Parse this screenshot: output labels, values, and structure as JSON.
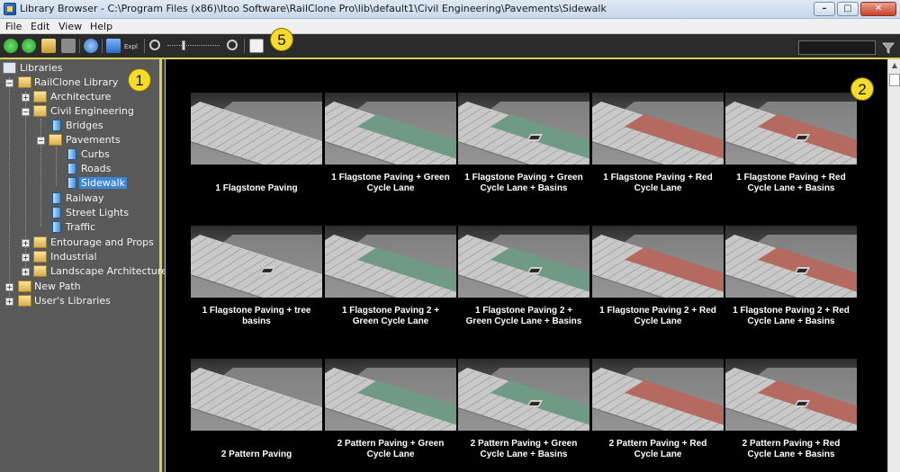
{
  "window": {
    "title": "Library Browser - C:\\Program Files (x86)\\Itoo Software\\RailClone Pro\\lib\\default1\\Civil Engineering\\Pavements\\Sidewalk"
  },
  "menu": [
    "File",
    "Edit",
    "View",
    "Help"
  ],
  "toolbar": {
    "buttons": [
      "back-arrow-icon",
      "forward-arrow-icon",
      "open-folder-icon",
      "save-icon",
      "refresh-icon",
      "export-icon",
      "zoom-out-icon",
      "zoom-in-icon",
      "checklist-icon"
    ],
    "export_label": "Expl",
    "search_value": ""
  },
  "callouts": [
    "1",
    "2",
    "5"
  ],
  "tree": [
    {
      "label": "Libraries",
      "icon": "libraries-icon"
    },
    {
      "label": "RailClone Library",
      "icon": "folder-open-icon"
    },
    {
      "label": "Architecture",
      "icon": "folder-icon"
    },
    {
      "label": "Civil Engineering",
      "icon": "folder-open-icon"
    },
    {
      "label": "Bridges",
      "icon": "book-icon"
    },
    {
      "label": "Pavements",
      "icon": "folder-open-icon"
    },
    {
      "label": "Curbs",
      "icon": "book-icon"
    },
    {
      "label": "Roads",
      "icon": "book-icon"
    },
    {
      "label": "Sidewalk",
      "icon": "book-icon",
      "selected": true
    },
    {
      "label": "Railway",
      "icon": "book-icon"
    },
    {
      "label": "Street Lights",
      "icon": "book-icon"
    },
    {
      "label": "Traffic",
      "icon": "book-icon"
    },
    {
      "label": "Entourage and Props",
      "icon": "folder-icon"
    },
    {
      "label": "Industrial",
      "icon": "folder-icon"
    },
    {
      "label": "Landscape Architecture",
      "icon": "folder-icon"
    },
    {
      "label": "New Path",
      "icon": "folder-icon"
    },
    {
      "label": "User's Libraries",
      "icon": "folder-icon"
    }
  ],
  "items": [
    {
      "line1": "1 Flagstone Paving",
      "line2": "",
      "lane": "none",
      "basin": false
    },
    {
      "line1": "1 Flagstone Paving + Green",
      "line2": "Cycle Lane",
      "lane": "green",
      "basin": false
    },
    {
      "line1": "1 Flagstone Paving + Green",
      "line2": "Cycle Lane + Basins",
      "lane": "green",
      "basin": true
    },
    {
      "line1": "1 Flagstone Paving + Red",
      "line2": "Cycle Lane",
      "lane": "red",
      "basin": false
    },
    {
      "line1": "1 Flagstone Paving + Red",
      "line2": "Cycle Lane + Basins",
      "lane": "red",
      "basin": true
    },
    {
      "line1": "1 Flagstone Paving + tree",
      "line2": "basins",
      "lane": "none",
      "basin": true
    },
    {
      "line1": "1 Flagstone Paving 2 +",
      "line2": "Green Cycle Lane",
      "lane": "green",
      "basin": false
    },
    {
      "line1": "1 Flagstone Paving 2 +",
      "line2": "Green Cycle Lane + Basins",
      "lane": "green",
      "basin": true
    },
    {
      "line1": "1 Flagstone Paving 2 + Red",
      "line2": "Cycle Lane",
      "lane": "red",
      "basin": false
    },
    {
      "line1": "1 Flagstone Paving 2 + Red",
      "line2": "Cycle Lane + Basins",
      "lane": "red",
      "basin": true
    },
    {
      "line1": "2 Pattern Paving",
      "line2": "",
      "lane": "none",
      "basin": false
    },
    {
      "line1": "2 Pattern Paving + Green",
      "line2": "Cycle Lane",
      "lane": "green",
      "basin": false
    },
    {
      "line1": "2 Pattern Paving + Green",
      "line2": "Cycle Lane + Basins",
      "lane": "green",
      "basin": true
    },
    {
      "line1": "2 Pattern Paving + Red",
      "line2": "Cycle Lane",
      "lane": "red",
      "basin": false
    },
    {
      "line1": "2 Pattern Paving + Red",
      "line2": "Cycle Lane + Basins",
      "lane": "red",
      "basin": true
    }
  ],
  "colors": {
    "accent": "#d8d05a",
    "selection": "#3f86d6",
    "callout": "#f6dc2a"
  }
}
